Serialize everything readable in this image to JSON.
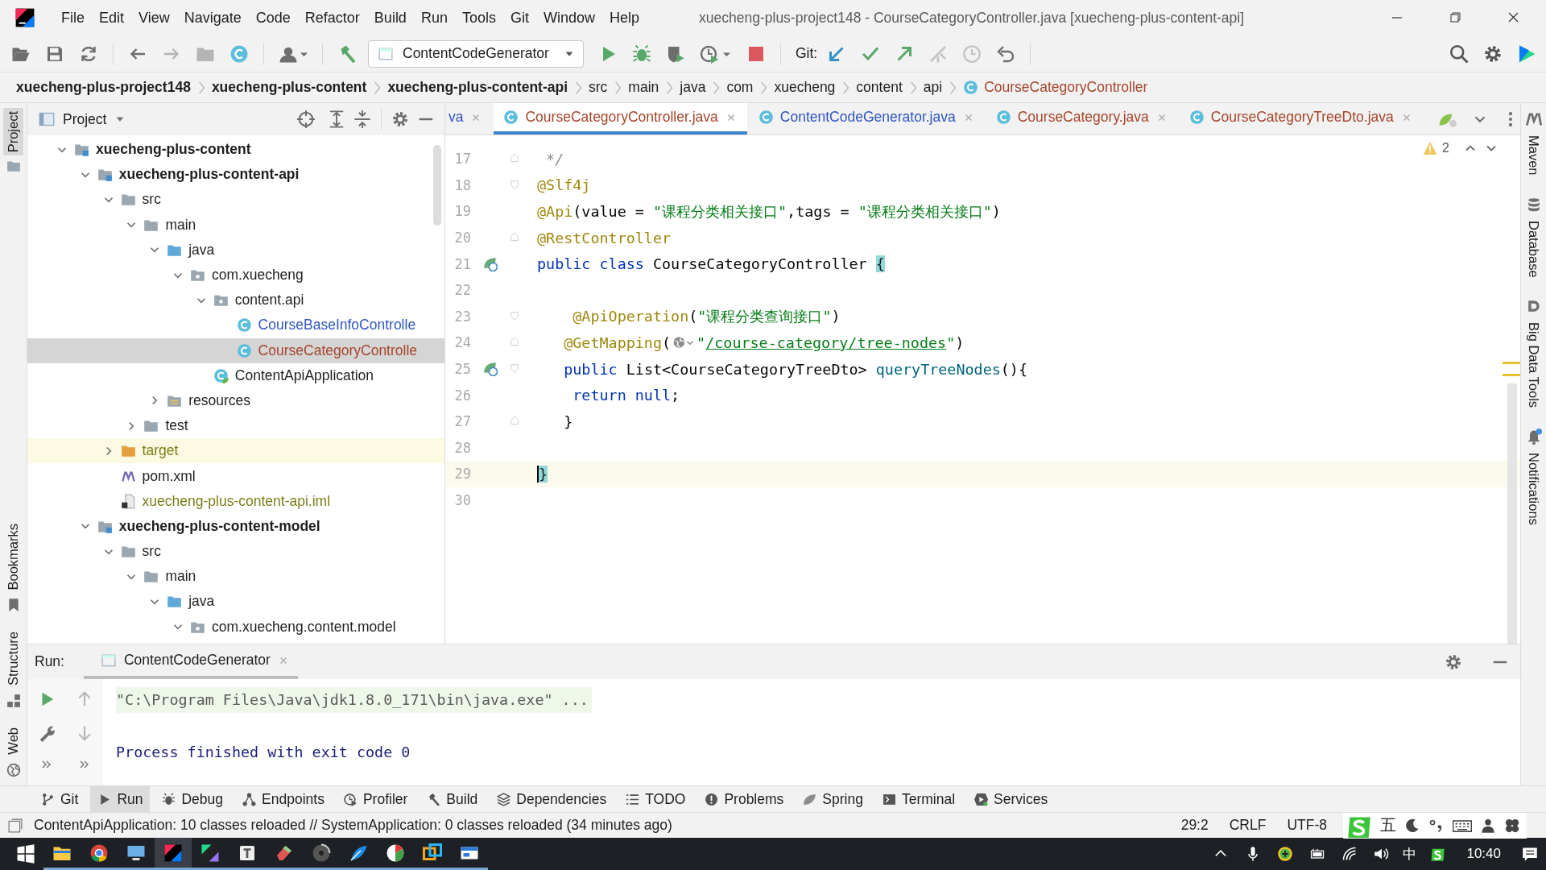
{
  "window": {
    "title": "xuecheng-plus-project148 - CourseCategoryController.java [xuecheng-plus-content-api]"
  },
  "menu": [
    "File",
    "Edit",
    "View",
    "Navigate",
    "Code",
    "Refactor",
    "Build",
    "Run",
    "Tools",
    "Git",
    "Window",
    "Help"
  ],
  "toolbar": {
    "run_config": "ContentCodeGenerator",
    "git_label": "Git:"
  },
  "breadcrumb": [
    {
      "label": "xuecheng-plus-project148",
      "kind": "module"
    },
    {
      "label": "xuecheng-plus-content",
      "kind": "module"
    },
    {
      "label": "xuecheng-plus-content-api",
      "kind": "module"
    },
    {
      "label": "src",
      "kind": "dir"
    },
    {
      "label": "main",
      "kind": "dir"
    },
    {
      "label": "java",
      "kind": "dir"
    },
    {
      "label": "com",
      "kind": "dir"
    },
    {
      "label": "xuecheng",
      "kind": "dir"
    },
    {
      "label": "content",
      "kind": "dir"
    },
    {
      "label": "api",
      "kind": "dir"
    },
    {
      "label": "CourseCategoryController",
      "kind": "class",
      "color": "#a5452a"
    }
  ],
  "left_stripe": {
    "top": [
      {
        "label": "Project",
        "selected": true
      }
    ],
    "bottom": [
      {
        "label": "Bookmarks",
        "selected": false
      },
      {
        "label": "Structure",
        "selected": false
      },
      {
        "label": "Web",
        "selected": false
      }
    ]
  },
  "right_stripe": [
    {
      "label": "Maven",
      "unread": false
    },
    {
      "label": "Database",
      "unread": false
    },
    {
      "label": "Big Data Tools",
      "unread": false
    },
    {
      "label": "Notifications",
      "unread": true
    }
  ],
  "project_panel": {
    "title": "Project",
    "tree": [
      {
        "label": "xuecheng-plus-content",
        "kind": "module",
        "selected": false,
        "expanded": true,
        "children": [
          {
            "label": "xuecheng-plus-content-api",
            "kind": "module",
            "selected": false,
            "expanded": true,
            "children": [
              {
                "label": "src",
                "kind": "folder",
                "selected": false,
                "expanded": true,
                "children": [
                  {
                    "label": "main",
                    "kind": "folder",
                    "selected": false,
                    "expanded": true,
                    "children": [
                      {
                        "label": "java",
                        "kind": "source",
                        "selected": false,
                        "expanded": true,
                        "children": [
                          {
                            "label": "com.xuecheng",
                            "kind": "package",
                            "selected": false,
                            "expanded": true,
                            "children": [
                              {
                                "label": "content.api",
                                "kind": "package",
                                "selected": false,
                                "expanded": true,
                                "children": [
                                  {
                                    "label": "CourseBaseInfoControlle",
                                    "kind": "class",
                                    "color": "#2f56c0",
                                    "selected": false
                                  },
                                  {
                                    "label": "CourseCategoryControlle",
                                    "kind": "class",
                                    "color": "#a5452a",
                                    "selected": true
                                  }
                                ]
                              },
                              {
                                "label": "ContentApiApplication",
                                "kind": "app",
                                "selected": false
                              }
                            ]
                          }
                        ]
                      },
                      {
                        "label": "resources",
                        "kind": "resources",
                        "selected": false,
                        "expanded": false
                      }
                    ]
                  },
                  {
                    "label": "test",
                    "kind": "folder",
                    "selected": false,
                    "expanded": false
                  }
                ]
              },
              {
                "label": "target",
                "kind": "target",
                "color": "#7b7d18",
                "selected": false,
                "expanded": false
              },
              {
                "label": "pom.xml",
                "kind": "xml",
                "selected": false
              },
              {
                "label": "xuecheng-plus-content-api.iml",
                "kind": "iml",
                "color": "#7b7d18",
                "selected": false
              }
            ]
          },
          {
            "label": "xuecheng-plus-content-model",
            "kind": "module",
            "selected": false,
            "expanded": true,
            "children": [
              {
                "label": "src",
                "kind": "folder",
                "selected": false,
                "expanded": true,
                "children": [
                  {
                    "label": "main",
                    "kind": "folder",
                    "selected": false,
                    "expanded": true,
                    "children": [
                      {
                        "label": "java",
                        "kind": "source",
                        "selected": false,
                        "expanded": true,
                        "children": [
                          {
                            "label": "com.xuecheng.content.model",
                            "kind": "package",
                            "selected": false,
                            "expanded": true
                          }
                        ]
                      }
                    ]
                  }
                ]
              }
            ]
          }
        ]
      }
    ]
  },
  "editor": {
    "tabs": [
      {
        "label": "va",
        "cut": true,
        "color": "#2f56c0",
        "selected": false
      },
      {
        "label": "CourseCategoryController.java",
        "cut": false,
        "color": "#a5452a",
        "selected": true
      },
      {
        "label": "ContentCodeGenerator.java",
        "cut": false,
        "color": "#2f56c0",
        "selected": false
      },
      {
        "label": "CourseCategory.java",
        "cut": false,
        "color": "#a5452a",
        "selected": false
      },
      {
        "label": "CourseCategoryTreeDto.java",
        "cut": false,
        "color": "#a5452a",
        "selected": false
      }
    ],
    "warnings": "2",
    "lines": [
      {
        "number": "17",
        "kind": "fold-end",
        "spring_marker": false,
        "current": false,
        "caret": false,
        "tokens": [
          {
            "text": " */",
            "kind": "comment"
          }
        ]
      },
      {
        "number": "18",
        "kind": "fold-start",
        "spring_marker": false,
        "current": false,
        "caret": false,
        "tokens": [
          {
            "text": "@Slf4j",
            "kind": "ann"
          }
        ]
      },
      {
        "number": "19",
        "kind": "plain",
        "spring_marker": false,
        "current": false,
        "caret": false,
        "tokens": [
          {
            "text": "@Api",
            "kind": "ann"
          },
          {
            "text": "(value = ",
            "kind": "plain"
          },
          {
            "text": "\"课程分类相关接口\"",
            "kind": "str"
          },
          {
            "text": ",tags = ",
            "kind": "plain"
          },
          {
            "text": "\"课程分类相关接口\"",
            "kind": "str"
          },
          {
            "text": ")",
            "kind": "plain"
          }
        ]
      },
      {
        "number": "20",
        "kind": "fold-end",
        "spring_marker": false,
        "current": false,
        "caret": false,
        "tokens": [
          {
            "text": "@RestController",
            "kind": "ann"
          }
        ]
      },
      {
        "number": "21",
        "kind": "plain",
        "spring_marker": true,
        "current": false,
        "caret": false,
        "tokens": [
          {
            "text": "public class ",
            "kind": "kw"
          },
          {
            "text": "CourseCategoryController ",
            "kind": "plain"
          },
          {
            "text": "{",
            "kind": "brace"
          }
        ]
      },
      {
        "number": "22",
        "kind": "plain",
        "spring_marker": false,
        "current": false,
        "caret": false
      },
      {
        "number": "23",
        "kind": "fold-start",
        "spring_marker": false,
        "current": false,
        "caret": false,
        "tokens": [
          {
            "text": "    @ApiOperation",
            "kind": "ann"
          },
          {
            "text": "(",
            "kind": "plain"
          },
          {
            "text": "\"课程分类查询接口\"",
            "kind": "str"
          },
          {
            "text": ")",
            "kind": "plain"
          }
        ]
      },
      {
        "number": "24",
        "kind": "fold-end",
        "spring_marker": false,
        "current": false,
        "caret": false,
        "tokens": [
          {
            "text": "   @GetMapping",
            "kind": "ann"
          },
          {
            "text": "(",
            "kind": "plain"
          },
          {
            "kind": "icon"
          },
          {
            "text": "\"",
            "kind": "str"
          },
          {
            "text": "/course-category/tree-nodes",
            "kind": "link"
          },
          {
            "text": "\"",
            "kind": "str"
          },
          {
            "text": ")",
            "kind": "plain"
          }
        ]
      },
      {
        "number": "25",
        "kind": "fold-start",
        "spring_marker": true,
        "current": false,
        "caret": false,
        "tokens": [
          {
            "text": "   public ",
            "kind": "kw"
          },
          {
            "text": "List<CourseCategoryTreeDto> ",
            "kind": "plain"
          },
          {
            "text": "queryTreeNodes",
            "kind": "method"
          },
          {
            "text": "(){",
            "kind": "plain"
          }
        ]
      },
      {
        "number": "26",
        "kind": "plain",
        "spring_marker": false,
        "current": false,
        "caret": false,
        "tokens": [
          {
            "text": "    return null",
            "kind": "kw"
          },
          {
            "text": ";",
            "kind": "plain"
          }
        ]
      },
      {
        "number": "27",
        "kind": "fold-end",
        "spring_marker": false,
        "current": false,
        "caret": false,
        "tokens": [
          {
            "text": "   }",
            "kind": "plain"
          }
        ]
      },
      {
        "number": "28",
        "kind": "plain",
        "spring_marker": false,
        "current": false,
        "caret": false
      },
      {
        "number": "29",
        "kind": "plain",
        "spring_marker": false,
        "current": true,
        "caret": true,
        "tokens": [
          {
            "text": "}",
            "kind": "brace"
          }
        ]
      },
      {
        "number": "30",
        "kind": "plain",
        "spring_marker": false,
        "current": false,
        "caret": false
      }
    ]
  },
  "run_panel": {
    "label": "Run:",
    "tab": "ContentCodeGenerator",
    "output": [
      {
        "text": "\"C:\\Program Files\\Java\\jdk1.8.0_171\\bin\\java.exe\" ...",
        "kind": "command"
      },
      {
        "text": "Process finished with exit code 0",
        "kind": "exit"
      }
    ]
  },
  "tool_windows": [
    {
      "label": "Git",
      "selected": false
    },
    {
      "label": "Run",
      "selected": true
    },
    {
      "label": "Debug",
      "selected": false
    },
    {
      "label": "Endpoints",
      "selected": false
    },
    {
      "label": "Profiler",
      "selected": false
    },
    {
      "label": "Build",
      "selected": false
    },
    {
      "label": "Dependencies",
      "selected": false
    },
    {
      "label": "TODO",
      "selected": false
    },
    {
      "label": "Problems",
      "selected": false
    },
    {
      "label": "Spring",
      "selected": false
    },
    {
      "label": "Terminal",
      "selected": false
    },
    {
      "label": "Services",
      "selected": false
    }
  ],
  "status_bar": {
    "message": "ContentApiApplication: 10 classes reloaded // SystemApplication: 0 classes reloaded (34 minutes ago)",
    "position": "29:2",
    "line_separator": "CRLF",
    "encoding": "UTF-8",
    "ime_mode": "五"
  },
  "taskbar": {
    "apps": [
      {
        "active": false
      },
      {
        "active": false
      },
      {
        "active": false
      },
      {
        "active": true
      },
      {
        "active": false
      },
      {
        "active": false
      },
      {
        "active": false
      },
      {
        "active": false
      },
      {
        "active": false
      },
      {
        "active": false
      },
      {
        "active": false
      },
      {
        "active": false
      }
    ],
    "input_language": "中",
    "time": "10:40"
  }
}
